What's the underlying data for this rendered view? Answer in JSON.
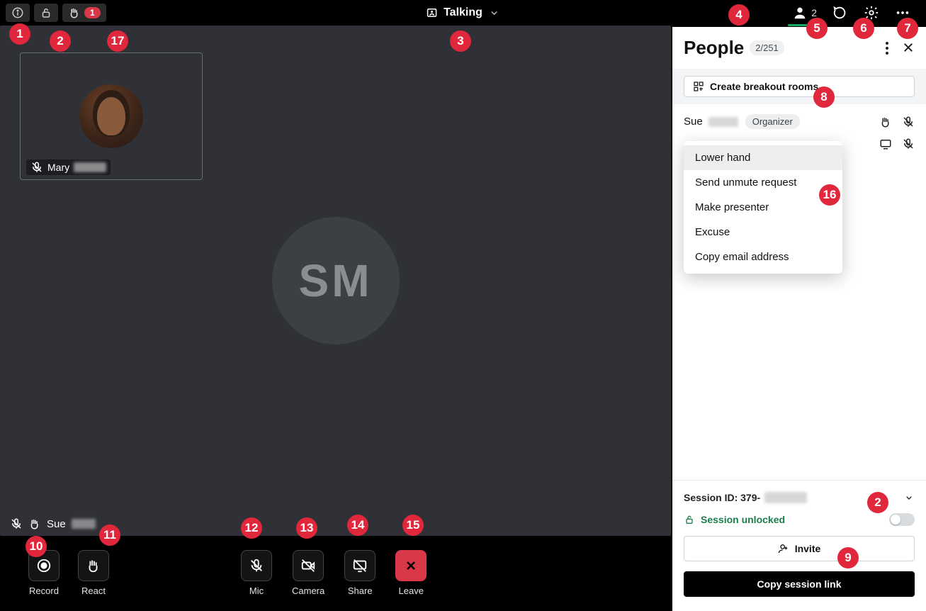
{
  "top": {
    "center_title": "Talking",
    "react_count": "1",
    "people_count_badge": "2"
  },
  "stage": {
    "thumb_name": "Mary",
    "big_initials": "SM",
    "footer_name": "Sue"
  },
  "bottom": {
    "record": "Record",
    "react": "React",
    "mic": "Mic",
    "camera": "Camera",
    "share": "Share",
    "leave": "Leave"
  },
  "panel": {
    "title": "People",
    "count": "2/251",
    "breakout_btn": "Create breakout rooms",
    "person1_name": "Sue",
    "organizer_pill": "Organizer",
    "ctx": {
      "lower_hand": "Lower hand",
      "unmute": "Send unmute request",
      "presenter": "Make presenter",
      "excuse": "Excuse",
      "copy_email": "Copy email address"
    },
    "session_id_label": "Session ID: 379-",
    "session_unlocked": "Session unlocked",
    "invite": "Invite",
    "copy_link": "Copy session link"
  },
  "markers": {
    "m1": "1",
    "m2": "2",
    "m3": "3",
    "m4": "4",
    "m5": "5",
    "m6": "6",
    "m7": "7",
    "m8": "8",
    "m9": "9",
    "m10": "10",
    "m11": "11",
    "m12": "12",
    "m13": "13",
    "m14": "14",
    "m15": "15",
    "m16": "16",
    "m17": "17"
  }
}
